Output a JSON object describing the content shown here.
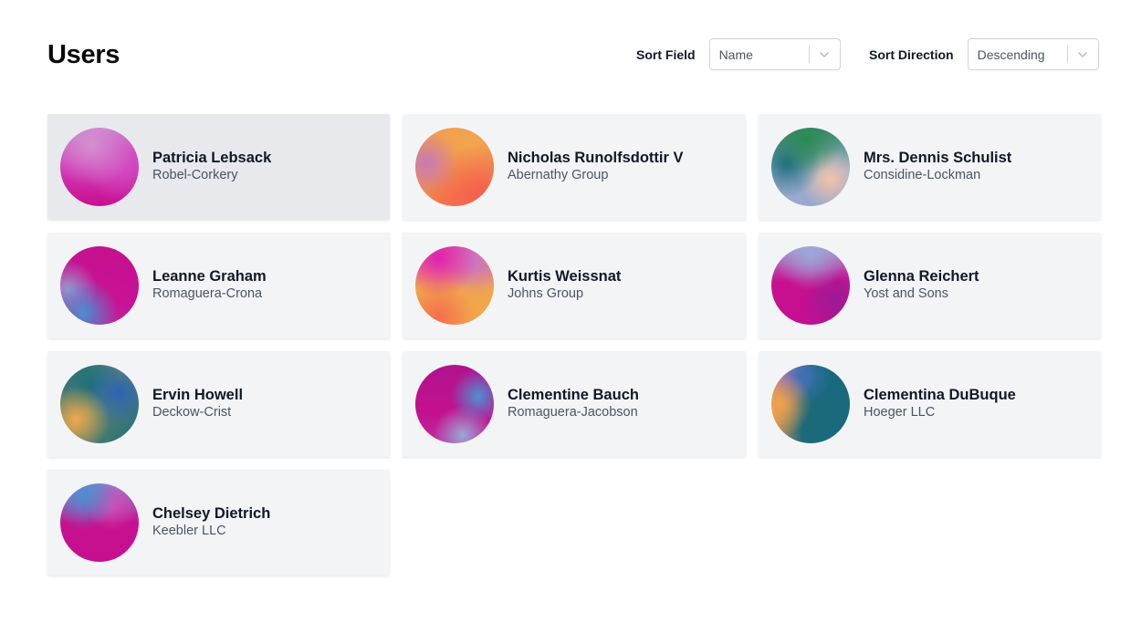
{
  "header": {
    "title": "Users"
  },
  "sort": {
    "field_label": "Sort Field",
    "field_value": "Name",
    "direction_label": "Sort Direction",
    "direction_value": "Descending"
  },
  "users": [
    {
      "name": "Patricia Lebsack",
      "company": "Robel-Corkery"
    },
    {
      "name": "Nicholas Runolfsdottir V",
      "company": "Abernathy Group"
    },
    {
      "name": "Mrs. Dennis Schulist",
      "company": "Considine-Lockman"
    },
    {
      "name": "Leanne Graham",
      "company": "Romaguera-Crona"
    },
    {
      "name": "Kurtis Weissnat",
      "company": "Johns Group"
    },
    {
      "name": "Glenna Reichert",
      "company": "Yost and Sons"
    },
    {
      "name": "Ervin Howell",
      "company": "Deckow-Crist"
    },
    {
      "name": "Clementine Bauch",
      "company": "Romaguera-Jacobson"
    },
    {
      "name": "Clementina DuBuque",
      "company": "Hoeger LLC"
    },
    {
      "name": "Chelsey Dietrich",
      "company": "Keebler LLC"
    }
  ],
  "icons": {
    "select_chevron": "chevron-down-icon"
  }
}
